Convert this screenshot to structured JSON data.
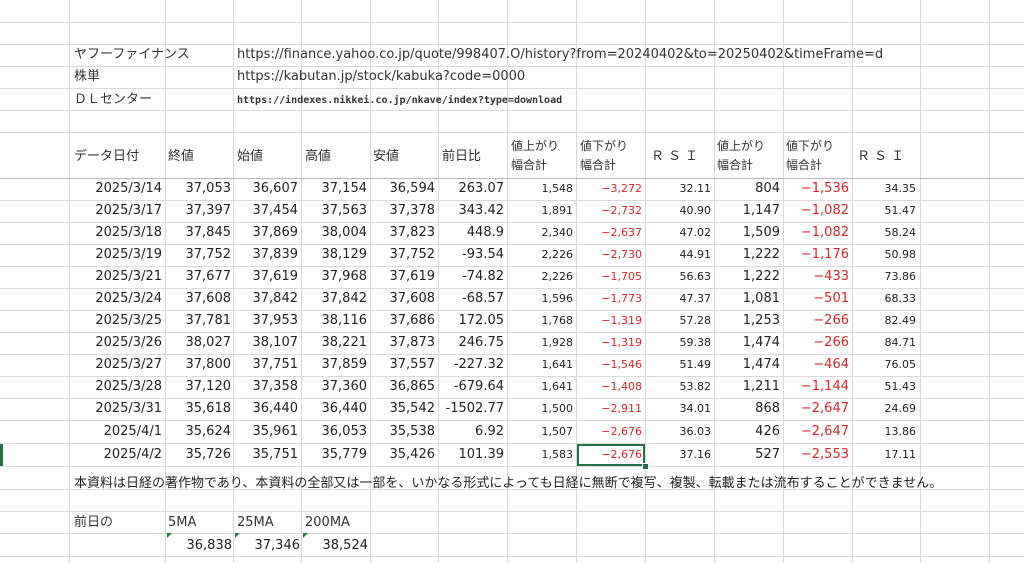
{
  "info": [
    {
      "label": "ヤフーファイナンス",
      "url": "https://finance.yahoo.co.jp/quote/998407.O/history?from=20240402&to=20250402&timeFrame=d"
    },
    {
      "label": "株単",
      "url": "https://kabutan.jp/stock/kabuka?code=0000"
    },
    {
      "label": "ＤＬセンター",
      "url": "https://indexes.nikkei.co.jp/nkave/index?type=download"
    }
  ],
  "headers": {
    "date": "データ日付",
    "close": "終値",
    "open": "始値",
    "high": "高値",
    "low": "安値",
    "change": "前日比",
    "up_sum_1": [
      "値上がり",
      "幅合計"
    ],
    "down_sum_1": [
      "値下がり",
      "幅合計"
    ],
    "rsi_1": "ＲＳＩ",
    "up_sum_2": [
      "値上がり",
      "幅合計"
    ],
    "down_sum_2": [
      "値下がり",
      "幅合計"
    ],
    "rsi_2": "ＲＳＩ"
  },
  "rows": [
    [
      "2025/3/14",
      "37,053",
      "36,607",
      "37,154",
      "36,594",
      "263.07",
      "1,548",
      "−3,272",
      "32.11",
      "804",
      "−1,536",
      "34.35"
    ],
    [
      "2025/3/17",
      "37,397",
      "37,454",
      "37,563",
      "37,378",
      "343.42",
      "1,891",
      "−2,732",
      "40.90",
      "1,147",
      "−1,082",
      "51.47"
    ],
    [
      "2025/3/18",
      "37,845",
      "37,869",
      "38,004",
      "37,823",
      "448.9",
      "2,340",
      "−2,637",
      "47.02",
      "1,509",
      "−1,082",
      "58.24"
    ],
    [
      "2025/3/19",
      "37,752",
      "37,839",
      "38,129",
      "37,752",
      "-93.54",
      "2,226",
      "−2,730",
      "44.91",
      "1,222",
      "−1,176",
      "50.98"
    ],
    [
      "2025/3/21",
      "37,677",
      "37,619",
      "37,968",
      "37,619",
      "-74.82",
      "2,226",
      "−1,705",
      "56.63",
      "1,222",
      "−433",
      "73.86"
    ],
    [
      "2025/3/24",
      "37,608",
      "37,842",
      "37,842",
      "37,608",
      "-68.57",
      "1,596",
      "−1,773",
      "47.37",
      "1,081",
      "−501",
      "68.33"
    ],
    [
      "2025/3/25",
      "37,781",
      "37,953",
      "38,116",
      "37,686",
      "172.05",
      "1,768",
      "−1,319",
      "57.28",
      "1,253",
      "−266",
      "82.49"
    ],
    [
      "2025/3/26",
      "38,027",
      "38,107",
      "38,221",
      "37,873",
      "246.75",
      "1,928",
      "−1,319",
      "59.38",
      "1,474",
      "−266",
      "84.71"
    ],
    [
      "2025/3/27",
      "37,800",
      "37,751",
      "37,859",
      "37,557",
      "-227.32",
      "1,641",
      "−1,546",
      "51.49",
      "1,474",
      "−464",
      "76.05"
    ],
    [
      "2025/3/28",
      "37,120",
      "37,358",
      "37,360",
      "36,865",
      "-679.64",
      "1,641",
      "−1,408",
      "53.82",
      "1,211",
      "−1,144",
      "51.43"
    ],
    [
      "2025/3/31",
      "35,618",
      "36,440",
      "36,440",
      "35,542",
      "-1502.77",
      "1,500",
      "−2,911",
      "34.01",
      "868",
      "−2,647",
      "24.69"
    ],
    [
      "2025/4/1",
      "35,624",
      "35,961",
      "36,053",
      "35,538",
      "6.92",
      "1,507",
      "−2,676",
      "36.03",
      "426",
      "−2,647",
      "13.86"
    ],
    [
      "2025/4/2",
      "35,726",
      "35,751",
      "35,779",
      "35,426",
      "101.39",
      "1,583",
      "−2,676",
      "37.16",
      "527",
      "−2,553",
      "17.11"
    ]
  ],
  "notice": "本資料は日経の著作物であり、本資料の全部又は一部を、いかなる形式によっても日経に無断で複写、複製、転載または流布することができません。",
  "ma": {
    "label": "前日の",
    "headers": [
      "5MA",
      "25MA",
      "200MA"
    ],
    "values": [
      "36,838",
      "37,346",
      "38,524"
    ]
  },
  "colors": {
    "negative": "#e0242a",
    "selection": "#217346",
    "gridline": "#dadada"
  }
}
